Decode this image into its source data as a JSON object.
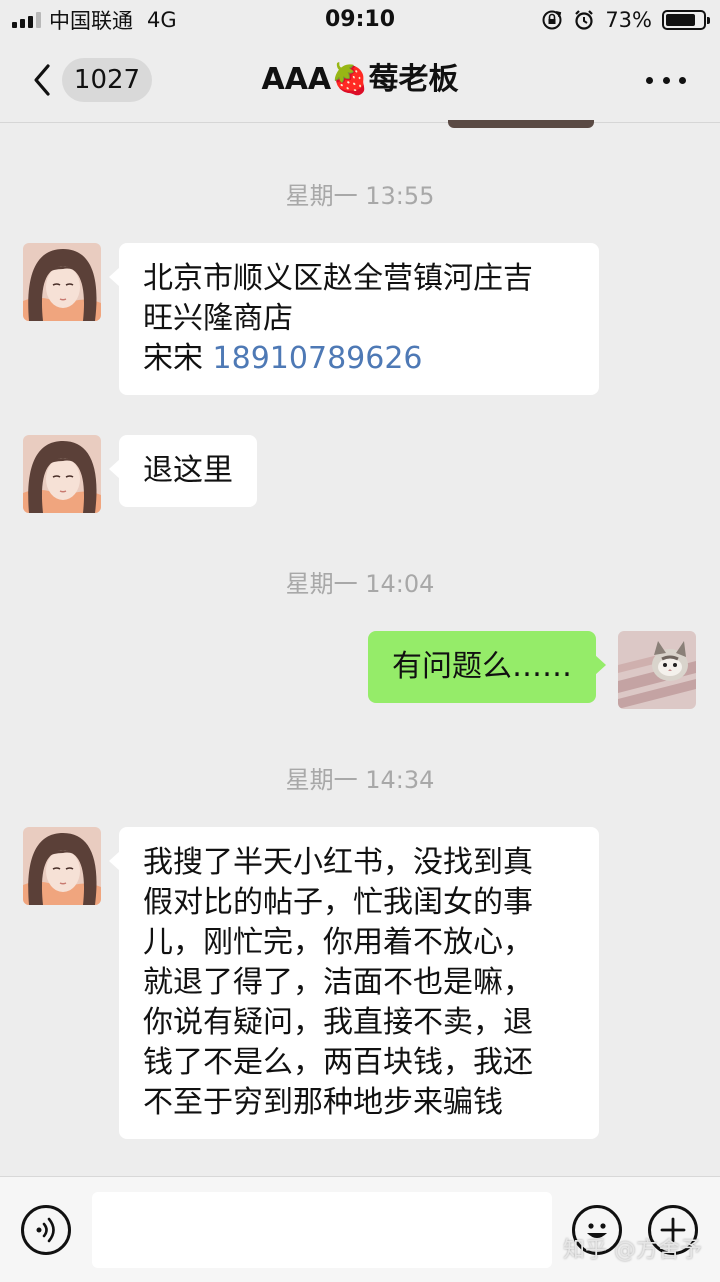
{
  "status_bar": {
    "carrier": "中国联通",
    "network": "4G",
    "time": "09:10",
    "battery": "73%",
    "battery_level": 0.73
  },
  "nav": {
    "unread_count": "1027",
    "title_prefix": "AAA",
    "title_emoji": "🍓",
    "title_suffix": "莓老板"
  },
  "messages": [
    {
      "type": "timestamp",
      "text": "星期一 13:55"
    },
    {
      "type": "received",
      "line1": "北京市顺义区赵全营镇河庄吉",
      "line2": "旺兴隆商店",
      "name": "宋宋",
      "phone": "18910789626"
    },
    {
      "type": "received",
      "text": "退这里"
    },
    {
      "type": "timestamp",
      "text": "星期一 14:04"
    },
    {
      "type": "sent",
      "text": "有问题么……"
    },
    {
      "type": "timestamp",
      "text": "星期一 14:34"
    },
    {
      "type": "received",
      "lines": [
        "我搜了半天小红书，没找到真",
        "假对比的帖子，忙我闺女的事",
        "儿，刚忙完，你用着不放心，",
        "就退了得了，洁面不也是嘛，",
        "你说有疑问，我直接不卖，退",
        "钱了不是么，两百块钱，我还",
        "不至于穷到那种地步来骗钱"
      ]
    }
  ],
  "input_bar": {
    "value": "",
    "placeholder": ""
  },
  "watermark": "知乎 @方舍予"
}
